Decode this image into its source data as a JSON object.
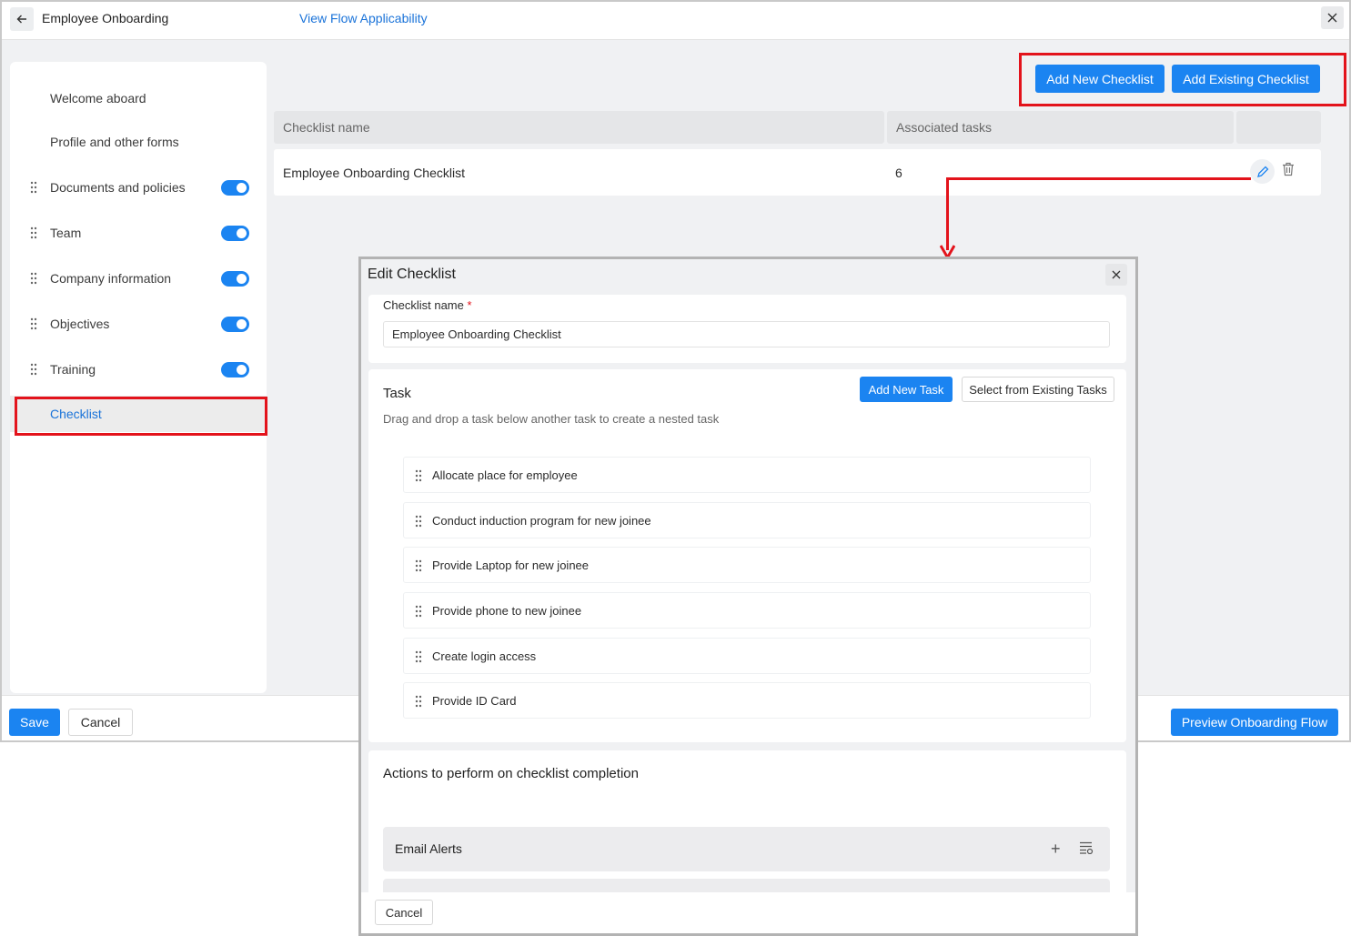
{
  "topbar": {
    "title": "Employee Onboarding",
    "link": "View Flow Applicability"
  },
  "sidebar": {
    "items": [
      {
        "label": "Welcome aboard",
        "draggable": false,
        "toggle": false
      },
      {
        "label": "Profile and other forms",
        "draggable": false,
        "toggle": false
      },
      {
        "label": "Documents and policies",
        "draggable": true,
        "toggle": true
      },
      {
        "label": "Team",
        "draggable": true,
        "toggle": true
      },
      {
        "label": "Company information",
        "draggable": true,
        "toggle": true
      },
      {
        "label": "Objectives",
        "draggable": true,
        "toggle": true
      },
      {
        "label": "Training",
        "draggable": true,
        "toggle": true
      },
      {
        "label": "Checklist",
        "draggable": false,
        "toggle": false,
        "active": true
      }
    ]
  },
  "actions": {
    "add_new": "Add New Checklist",
    "add_existing": "Add Existing Checklist"
  },
  "table": {
    "headers": [
      "Checklist name",
      "Associated tasks",
      ""
    ],
    "rows": [
      {
        "name": "Employee Onboarding Checklist",
        "tasks": "6"
      }
    ]
  },
  "footer": {
    "save": "Save",
    "cancel": "Cancel",
    "preview": "Preview Onboarding Flow"
  },
  "modal": {
    "title": "Edit Checklist",
    "name_label": "Checklist name",
    "required_mark": "*",
    "name_value": "Employee Onboarding Checklist",
    "task_title": "Task",
    "task_hint": "Drag and drop a task below another task to create a nested task",
    "add_task": "Add New Task",
    "select_existing": "Select from Existing Tasks",
    "tasks": [
      "Allocate place for employee",
      "Conduct induction program for new joinee",
      "Provide Laptop for new joinee",
      "Provide phone to new joinee",
      "Create login access",
      "Provide ID Card"
    ],
    "actions_title": "Actions to perform on checklist completion",
    "email_alerts": "Email Alerts",
    "plus_symbol": "+",
    "cancel": "Cancel"
  },
  "colors": {
    "accent": "#1b84f1",
    "link": "#1a73d9",
    "highlight": "#e3131b"
  }
}
